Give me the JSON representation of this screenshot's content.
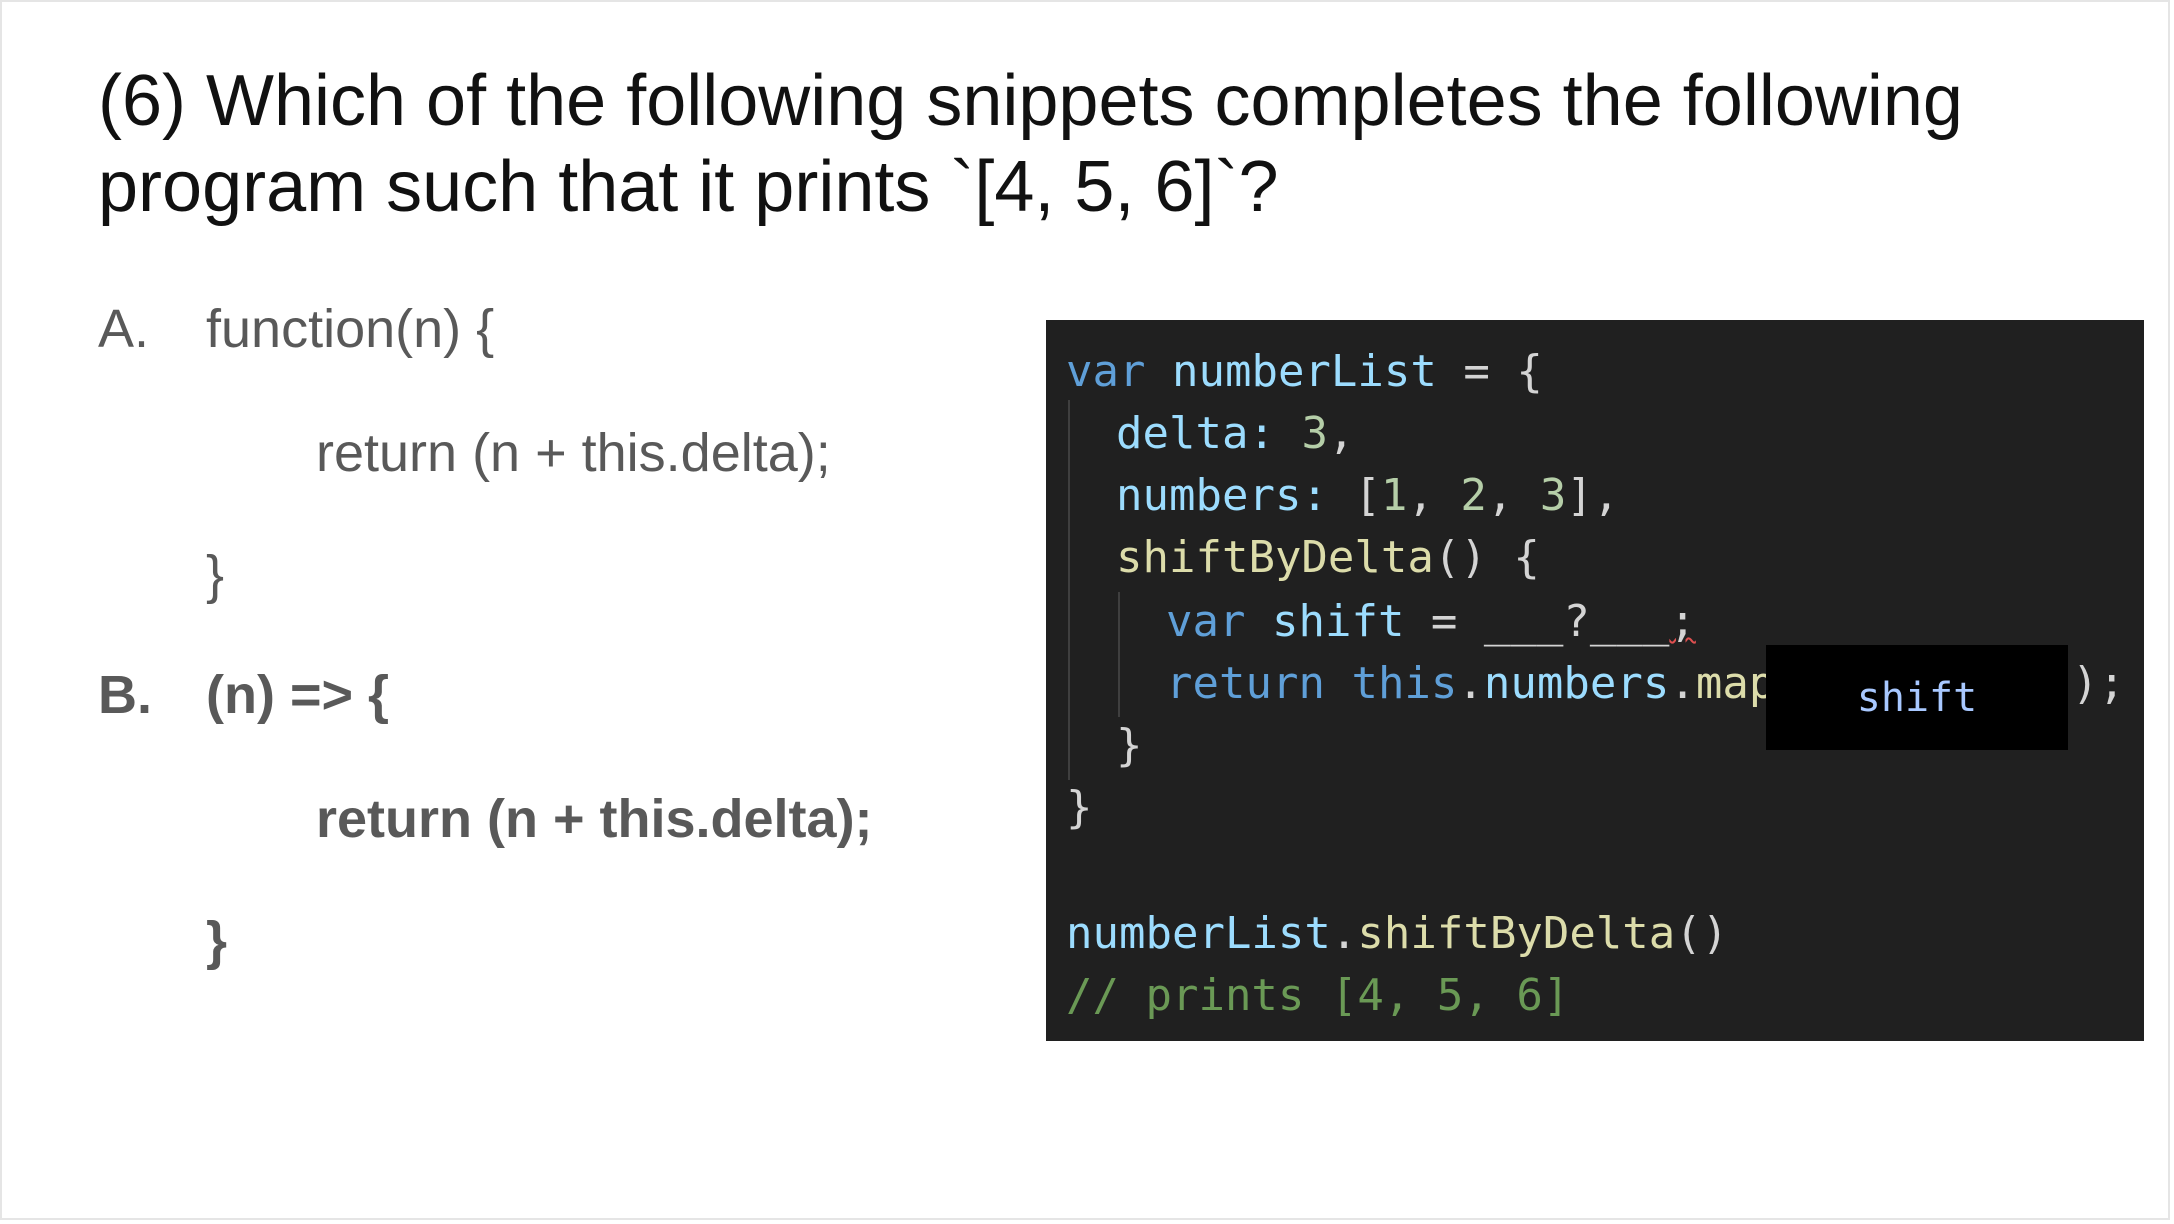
{
  "question": {
    "line1": "(6) Which of the following snippets completes the following",
    "line2": "program such that it prints `[4, 5, 6]`?"
  },
  "options": [
    {
      "letter": "A.",
      "line1": "function(n) {",
      "line2": "return (n + this.delta);",
      "line3": "}"
    },
    {
      "letter": "B.",
      "line1": "(n) => {",
      "line2": "return (n + this.delta);",
      "line3": "}"
    }
  ],
  "code": {
    "l1": {
      "kw": "var",
      "name": "numberList",
      "rest": " = {"
    },
    "l2": {
      "key": "delta:",
      "num": "3",
      "rest": ","
    },
    "l3": {
      "key": "numbers:",
      "open": "[",
      "n1": "1",
      "s1": ", ",
      "n2": "2",
      "s2": ", ",
      "n3": "3",
      "close": "],"
    },
    "l4": {
      "fn": "shiftByDelta",
      "rest": "() {"
    },
    "l5": {
      "kw": "var",
      "name": "shift",
      "eq": " = ",
      "blank": "___?___",
      "semi": ";"
    },
    "l6": {
      "kw": "return",
      "this": "this",
      "dot1": ".",
      "prop": "numbers",
      "dot2": ".",
      "fn": "map",
      "paren": "(",
      "tail": ");"
    },
    "l7": "}",
    "l8": "}",
    "l10": {
      "obj": "numberList",
      "dot": ".",
      "fn": "shiftByDelta",
      "rest": "()"
    },
    "l11": "// prints [4, 5, 6]",
    "overlay_label": "shift"
  }
}
